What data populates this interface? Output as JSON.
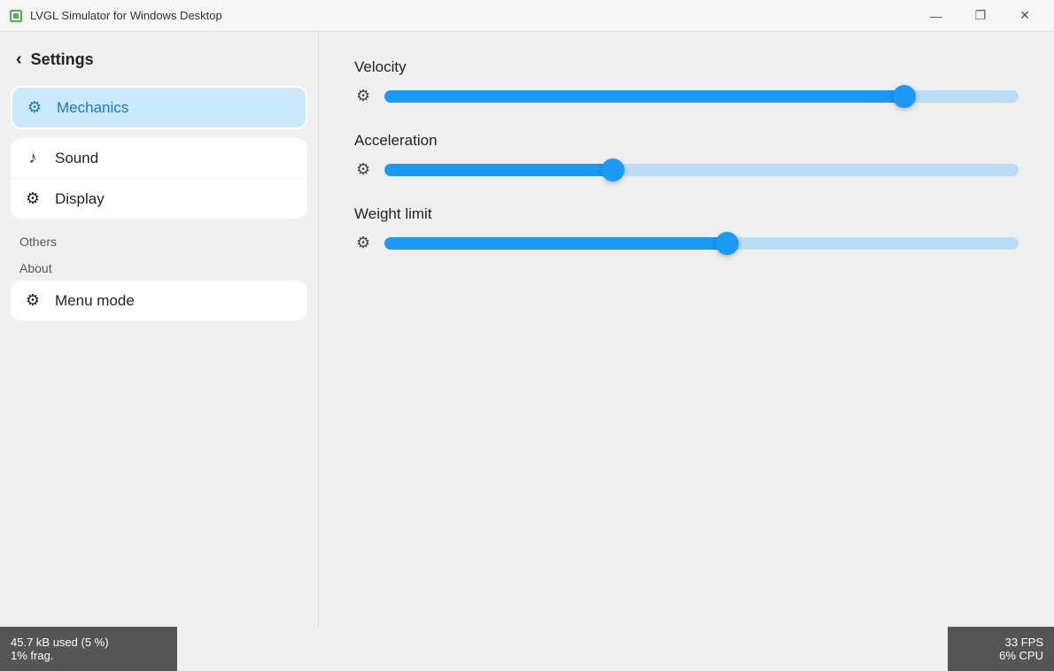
{
  "window": {
    "title": "LVGL Simulator for Windows Desktop",
    "icon_label": "app-icon",
    "min_btn": "—",
    "restore_btn": "❐",
    "close_btn": "✕"
  },
  "sidebar": {
    "back_label": "Settings",
    "groups": [
      {
        "id": "mechanics-group",
        "items": [
          {
            "id": "mechanics",
            "label": "Mechanics",
            "icon": "⚙",
            "active": true
          }
        ]
      },
      {
        "id": "sound-display-group",
        "items": [
          {
            "id": "sound",
            "label": "Sound",
            "icon": "♪",
            "active": false
          },
          {
            "id": "display",
            "label": "Display",
            "icon": "⚙",
            "active": false
          }
        ]
      }
    ],
    "section_others": "Others",
    "section_about": "About",
    "about_group": [
      {
        "id": "menu-mode",
        "label": "Menu mode",
        "icon": "⚙",
        "active": false
      }
    ]
  },
  "content": {
    "settings": [
      {
        "id": "velocity",
        "label": "Velocity",
        "fill_percent": 82,
        "thumb_percent": 82
      },
      {
        "id": "acceleration",
        "label": "Acceleration",
        "fill_percent": 36,
        "thumb_percent": 36
      },
      {
        "id": "weight-limit",
        "label": "Weight limit",
        "fill_percent": 54,
        "thumb_percent": 54
      }
    ]
  },
  "status": {
    "left_line1": "45.7 kB used (5 %)",
    "left_line2": "1% frag.",
    "right_line1": "33 FPS",
    "right_line2": "6% CPU"
  }
}
